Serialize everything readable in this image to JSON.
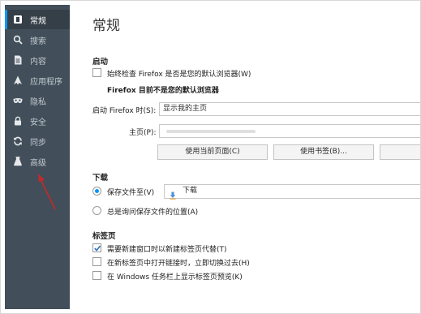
{
  "sidebar": {
    "items": [
      {
        "label": "常规",
        "icon": "general-icon"
      },
      {
        "label": "搜索",
        "icon": "search-icon"
      },
      {
        "label": "内容",
        "icon": "content-icon"
      },
      {
        "label": "应用程序",
        "icon": "applications-icon"
      },
      {
        "label": "隐私",
        "icon": "privacy-mask-icon"
      },
      {
        "label": "安全",
        "icon": "lock-icon"
      },
      {
        "label": "同步",
        "icon": "sync-icon"
      },
      {
        "label": "高级",
        "icon": "advanced-icon"
      }
    ],
    "active_index": 0
  },
  "page": {
    "title": "常规"
  },
  "startup": {
    "heading": "启动",
    "default_check_label": "始终检查 Firefox 是否是您的默认浏览器(W)",
    "default_check_checked": false,
    "not_default_text": "Firefox 目前不是您的默认浏览器",
    "when_starts_label": "启动 Firefox 时(S):",
    "when_starts_value": "显示我的主页",
    "homepage_label": "主页(P):",
    "use_current_button": "使用当前页面(C)",
    "use_bookmark_button": "使用书签(B)..."
  },
  "downloads": {
    "heading": "下载",
    "save_to_label": "保存文件至(V)",
    "save_to_selected": true,
    "folder_name": "下载",
    "folder_icon": "folder-icon",
    "always_ask_label": "总是询问保存文件的位置(A)",
    "always_ask_selected": false
  },
  "tabs": {
    "heading": "标签页",
    "options": [
      {
        "label": "需要新建窗口时以新建标签页代替(T)",
        "checked": true
      },
      {
        "label": "在新标签页中打开链接时，立即切换过去(H)",
        "checked": false
      },
      {
        "label": "在 Windows 任务栏上显示标签页预览(K)",
        "checked": false
      }
    ]
  },
  "colors": {
    "sidebar_bg": "#424f5a",
    "sidebar_active": "#343f48",
    "accent": "#0996f8",
    "annotation_arrow": "#c62828"
  }
}
